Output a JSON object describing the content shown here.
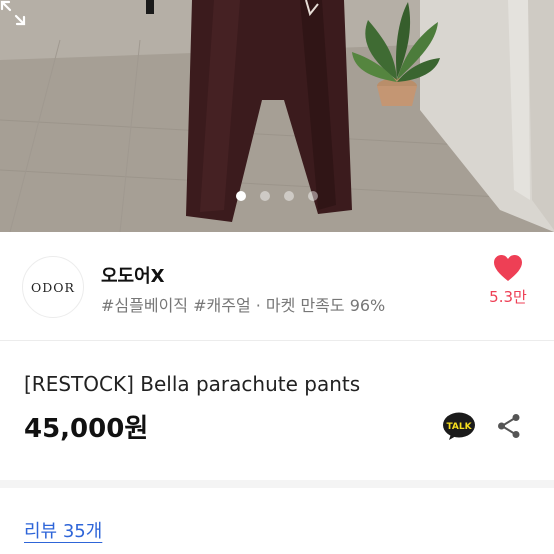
{
  "gallery": {
    "page_count": 4,
    "active_index": 0,
    "expand_icon": "expand-icon"
  },
  "shop": {
    "logo_text": "ODOR",
    "name": "오도어X",
    "tags": "#심플베이직 #캐주얼 · 마켓 만족도 96%",
    "like_count": "5.3만",
    "like_color": "#ee3f55"
  },
  "product": {
    "title": "[RESTOCK] Bella parachute pants",
    "price": "45,000원",
    "talk_label": "TALK",
    "talk_color": "#1b1b1b",
    "talk_badge_color": "#f7df1e"
  },
  "reviews": {
    "label": "리뷰 35개",
    "color": "#2e65d8"
  }
}
